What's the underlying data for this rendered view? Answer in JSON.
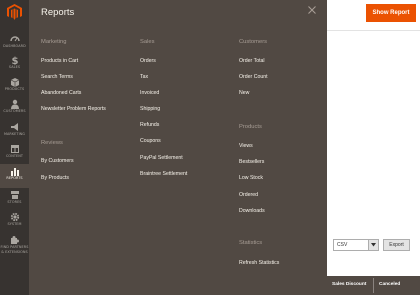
{
  "nav": {
    "items": [
      {
        "label": "DASHBOARD",
        "icon": "dashboard-icon"
      },
      {
        "label": "SALES",
        "icon": "dollar-icon"
      },
      {
        "label": "PRODUCTS",
        "icon": "box-icon"
      },
      {
        "label": "CUSTOMERS",
        "icon": "person-icon"
      },
      {
        "label": "MARKETING",
        "icon": "megaphone-icon"
      },
      {
        "label": "CONTENT",
        "icon": "layout-icon"
      },
      {
        "label": "REPORTS",
        "icon": "bar-chart-icon"
      },
      {
        "label": "STORES",
        "icon": "store-icon"
      },
      {
        "label": "SYSTEM",
        "icon": "gear-icon"
      },
      {
        "label": "FIND PARTNERS",
        "icon": "puzzle-icon"
      },
      {
        "label": "& EXTENSIONS",
        "icon": ""
      }
    ]
  },
  "panel": {
    "title": "Reports",
    "marketing": {
      "heading": "Marketing",
      "links": [
        "Products in Cart",
        "Search Terms",
        "Abandoned Carts",
        "Newsletter Problem Reports"
      ]
    },
    "reviews": {
      "heading": "Reviews",
      "links": [
        "By Customers",
        "By Products"
      ]
    },
    "sales": {
      "heading": "Sales",
      "links": [
        "Orders",
        "Tax",
        "Invoiced",
        "Shipping",
        "Refunds",
        "Coupons",
        "PayPal Settlement",
        "Braintree Settlement"
      ]
    },
    "customers": {
      "heading": "Customers",
      "links": [
        "Order Total",
        "Order Count",
        "New"
      ]
    },
    "products": {
      "heading": "Products",
      "links": [
        "Views",
        "Bestsellers",
        "Low Stock",
        "Ordered",
        "Downloads"
      ]
    },
    "statistics": {
      "heading": "Statistics",
      "links": [
        "Refresh Statistics"
      ]
    }
  },
  "page": {
    "show_report_label": "Show Report",
    "export_format": "CSV",
    "export_label": "Export",
    "grid_columns": [
      "Sales Discount",
      "Canceled"
    ]
  },
  "colors": {
    "accent": "#eb5202",
    "nav_bg": "#373330",
    "panel_bg": "#514943"
  }
}
